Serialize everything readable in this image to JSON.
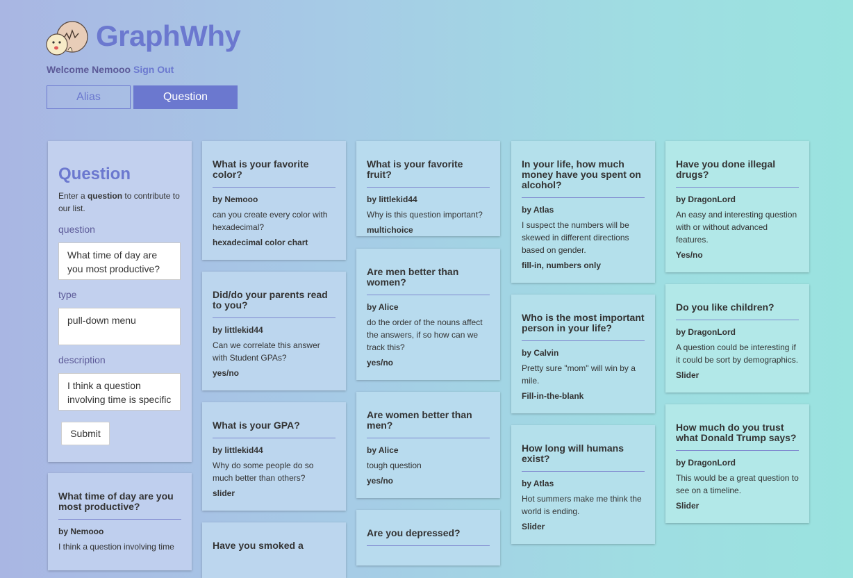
{
  "app": {
    "title": "GraphWhy"
  },
  "header": {
    "welcome": "Welcome Nemooo",
    "sign_out": "Sign Out"
  },
  "tabs": [
    {
      "label": "Alias"
    },
    {
      "label": "Question"
    }
  ],
  "form": {
    "title": "Question",
    "intro_prefix": "Enter a ",
    "intro_bold": "question",
    "intro_suffix": " to contribute to our list.",
    "question_label": "question",
    "question_value": "What time of day are you most productive?",
    "type_label": "type",
    "type_value": "pull-down menu",
    "description_label": "description",
    "description_value": "I think a question involving time is specific enough to interest...",
    "submit": "Submit"
  },
  "cards": [
    {
      "title": "What time of day are you most productive?",
      "author": "by Nemooo",
      "description": "I think a question involving time",
      "type": ""
    },
    {
      "title": "What is your favorite color?",
      "author": "by Nemooo",
      "description": "can you create every color with hexadecimal?",
      "type": "hexadecimal color chart"
    },
    {
      "title": "Did/do your parents read to you?",
      "author": "by littlekid44",
      "description": "Can we correlate this answer with Student GPAs?",
      "type": "yes/no"
    },
    {
      "title": "What is your GPA?",
      "author": "by littlekid44",
      "description": "Why do some people do so much better than others?",
      "type": "slider"
    },
    {
      "title": "Have you smoked a",
      "author": "",
      "description": "",
      "type": ""
    },
    {
      "title": "What is your favorite fruit?",
      "author": "by littlekid44",
      "description": "Why is this question important?",
      "type": "multichoice"
    },
    {
      "title": "Are men better than women?",
      "author": "by Alice",
      "description": "do the order of the nouns affect the answers, if so how can we track this?",
      "type": "yes/no"
    },
    {
      "title": "Are women better than men?",
      "author": "by Alice",
      "description": "tough question",
      "type": "yes/no"
    },
    {
      "title": "Are you depressed?",
      "author": "",
      "description": "",
      "type": ""
    },
    {
      "title": "In your life, how much money have you spent on alcohol?",
      "author": "by Atlas",
      "description": "I suspect the numbers will be skewed in different directions based on gender.",
      "type": "fill-in, numbers only"
    },
    {
      "title": "Who is the most important person in your life?",
      "author": "by Calvin",
      "description": "Pretty sure \"mom\" will win by a mile.",
      "type": "Fill-in-the-blank"
    },
    {
      "title": "How long will humans exist?",
      "author": "by Atlas",
      "description": "Hot summers make me think the world is ending.",
      "type": "Slider"
    },
    {
      "title": "Have you done illegal drugs?",
      "author": "by DragonLord",
      "description": "An easy and interesting question with or without advanced features.",
      "type": "Yes/no"
    },
    {
      "title": "Do you like children?",
      "author": "by DragonLord",
      "description": "A question could be interesting if it could be sort by demographics.",
      "type": "Slider"
    },
    {
      "title": "How much do you trust what Donald Trump says?",
      "author": "by DragonLord",
      "description": "This would be a great question to see on a timeline.",
      "type": "Slider"
    }
  ]
}
